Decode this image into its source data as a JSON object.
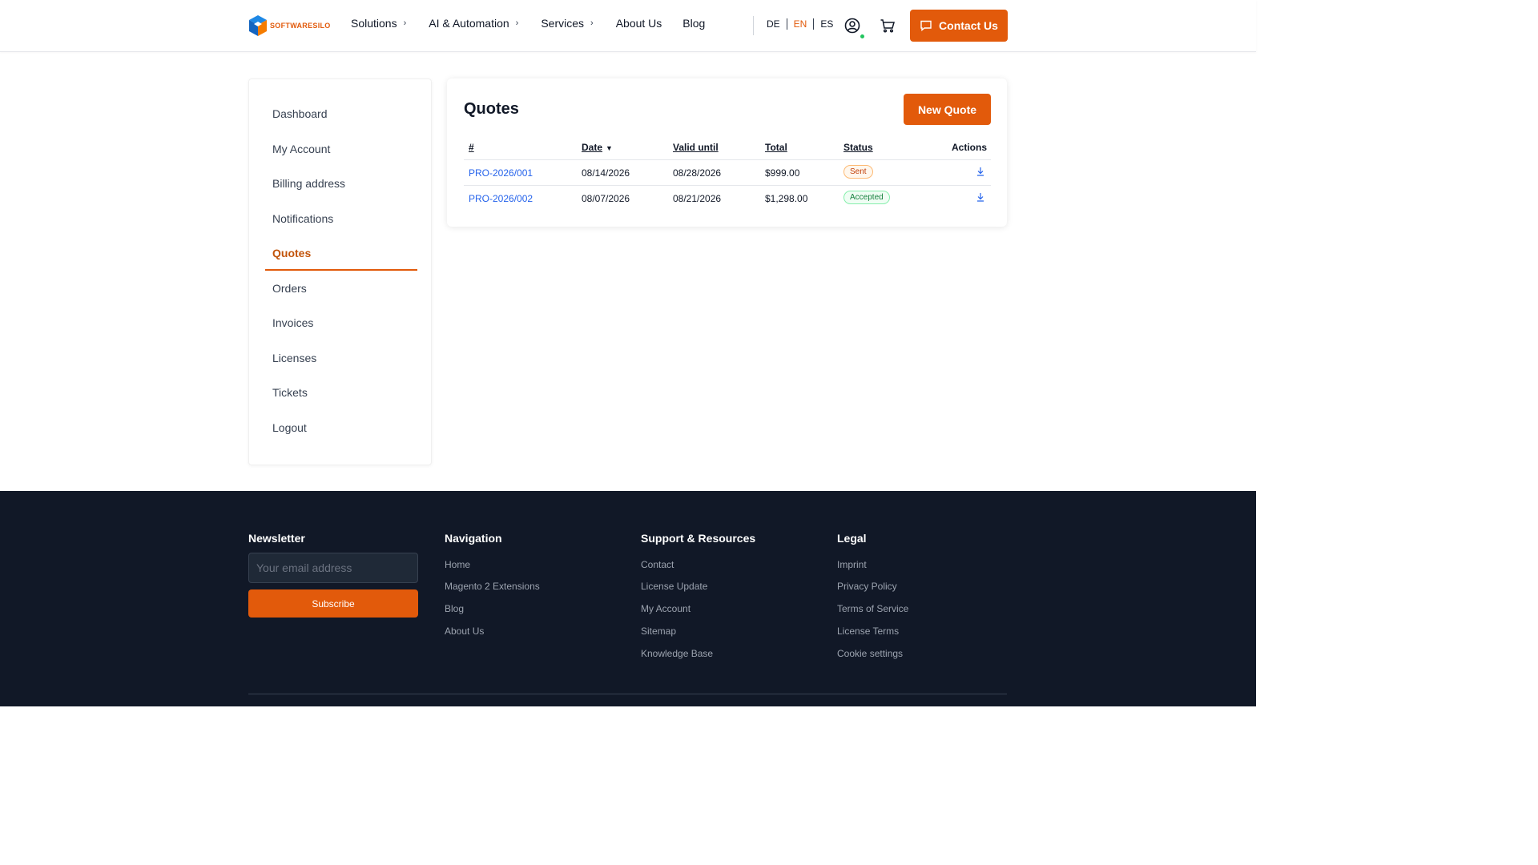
{
  "header": {
    "logo_text": "SOFTWARESILO",
    "nav": [
      {
        "label": "Solutions",
        "has_chevron": true
      },
      {
        "label": "AI & Automation",
        "has_chevron": true
      },
      {
        "label": "Services",
        "has_chevron": true
      },
      {
        "label": "About Us",
        "has_chevron": false
      },
      {
        "label": "Blog",
        "has_chevron": false
      }
    ],
    "languages": [
      {
        "label": "DE",
        "active": false
      },
      {
        "label": "EN",
        "active": true
      },
      {
        "label": "ES",
        "active": false
      }
    ],
    "contact_label": "Contact Us",
    "icons": {
      "user": "user-circle-icon",
      "cart": "cart-icon",
      "contact": "chat-bubble-icon"
    }
  },
  "sidebar": {
    "items": [
      {
        "label": "Dashboard",
        "active": false
      },
      {
        "label": "My Account",
        "active": false
      },
      {
        "label": "Billing address",
        "active": false
      },
      {
        "label": "Notifications",
        "active": false
      },
      {
        "label": "Quotes",
        "active": true
      },
      {
        "label": "Orders",
        "active": false
      },
      {
        "label": "Invoices",
        "active": false
      },
      {
        "label": "Licenses",
        "active": false
      },
      {
        "label": "Tickets",
        "active": false
      },
      {
        "label": "Logout",
        "active": false
      }
    ]
  },
  "main": {
    "title": "Quotes",
    "new_quote_label": "New Quote",
    "table": {
      "headers": {
        "number": "#",
        "date": "Date",
        "valid_until": "Valid until",
        "total": "Total",
        "status": "Status",
        "actions": "Actions"
      },
      "sort_indicator": "▼",
      "rows": [
        {
          "number": "PRO-2026/001",
          "date": "08/14/2026",
          "valid_until": "08/28/2026",
          "total": "$999.00",
          "status": "Sent"
        },
        {
          "number": "PRO-2026/002",
          "date": "08/07/2026",
          "valid_until": "08/21/2026",
          "total": "$1,298.00",
          "status": "Accepted"
        }
      ]
    }
  },
  "footer": {
    "newsletter": {
      "title": "Newsletter",
      "placeholder": "Your email address",
      "button": "Subscribe"
    },
    "navigation": {
      "title": "Navigation",
      "links": [
        "Home",
        "Magento 2 Extensions",
        "Blog",
        "About Us"
      ]
    },
    "support": {
      "title": "Support & Resources",
      "links": [
        "Contact",
        "License Update",
        "My Account",
        "Sitemap",
        "Knowledge Base"
      ]
    },
    "legal": {
      "title": "Legal",
      "links": [
        "Imprint",
        "Privacy Policy",
        "Terms of Service",
        "License Terms",
        "Cookie settings"
      ]
    }
  },
  "colors": {
    "accent": "#e25a0b",
    "footer_bg": "#111827",
    "link": "#2563eb"
  }
}
